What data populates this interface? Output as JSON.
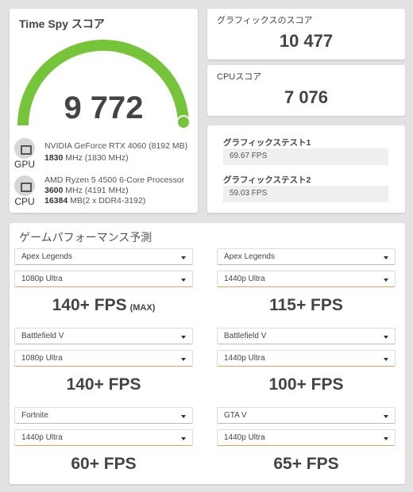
{
  "timespy": {
    "title": "Time Spy スコア",
    "score": "9 772",
    "gauge_fraction": 1.0,
    "gauge_color": "#76c43a",
    "gpu": {
      "label": "GPU",
      "name": "NVIDIA GeForce RTX 4060 (8192 MB)",
      "clock": "1830",
      "clock_rest": " MHz (1830 MHz)"
    },
    "cpu": {
      "label": "CPU",
      "name": "AMD Ryzen 5 4500 6-Core Processor",
      "clock": "3600",
      "clock_rest": " MHz (4191 MHz)",
      "mem": "16384",
      "mem_rest": " MB(2 x DDR4-3192)"
    }
  },
  "graphics_score": {
    "title": "グラフィックスのスコア",
    "value": "10 477"
  },
  "cpu_score": {
    "title": "CPUスコア",
    "value": "7 076"
  },
  "tests": [
    {
      "title": "グラフィックステスト1",
      "value": "69.67 FPS"
    },
    {
      "title": "グラフィックステスト2",
      "value": "59.03 FPS"
    }
  ],
  "games": {
    "title": "ゲームパフォーマンス予測",
    "items": [
      {
        "game": "Apex Legends",
        "resolution": "1080p Ultra",
        "fps": "140+ FPS",
        "note": "(MAX)"
      },
      {
        "game": "Apex Legends",
        "resolution": "1440p Ultra",
        "fps": "115+ FPS"
      },
      {
        "game": "Battlefield V",
        "resolution": "1080p Ultra",
        "fps": "140+ FPS"
      },
      {
        "game": "Battlefield V",
        "resolution": "1440p Ultra",
        "fps": "100+ FPS"
      },
      {
        "game": "Fortnite",
        "resolution": "1440p Ultra",
        "fps": "60+ FPS"
      },
      {
        "game": "GTA V",
        "resolution": "1440p Ultra",
        "fps": "65+ FPS"
      }
    ]
  }
}
